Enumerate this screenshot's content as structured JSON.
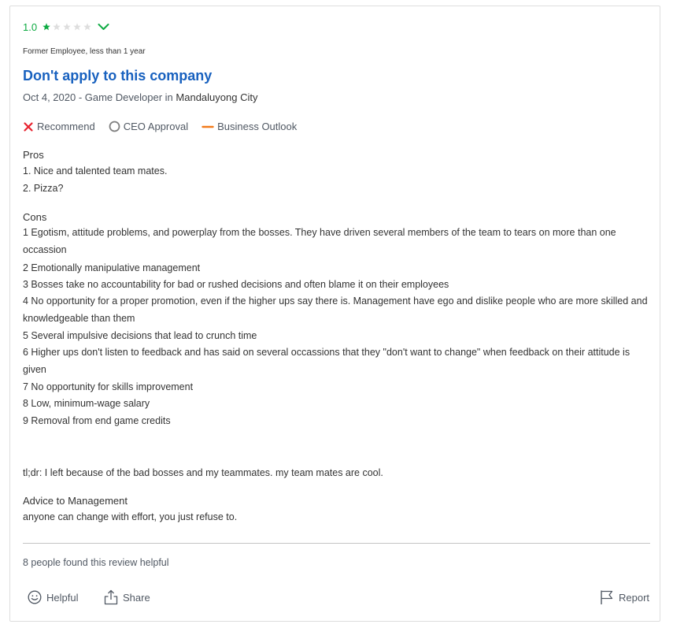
{
  "review": {
    "rating_value": "1.0",
    "rating_stars_filled": 1,
    "rating_stars_total": 5,
    "employee_status": "Former Employee, less than 1 year",
    "title": "Don't apply to this company",
    "date_role": "Oct 4, 2020 - Game Developer",
    "in_word": "in",
    "location": "Mandaluyong City",
    "indicators": {
      "recommend": "Recommend",
      "ceo_approval": "CEO Approval",
      "business_outlook": "Business Outlook"
    },
    "pros_heading": "Pros",
    "pros": [
      "1. Nice and talented team mates.",
      "2. Pizza?"
    ],
    "cons_heading": "Cons",
    "cons": [
      "1 Egotism, attitude problems, and powerplay from the bosses. They have driven several members of the team to tears on more than one occassion",
      "2 Emotionally manipulative management",
      "3 Bosses take no accountability for bad or rushed decisions and often blame it on their employees",
      "4 No opportunity for a proper promotion, even if the higher ups say there is. Management have ego and dislike people who are more skilled and knowledgeable than them",
      "5 Several impulsive decisions that lead to crunch time",
      "6 Higher ups don't listen to feedback and has said on several occassions that they \"don't want to change\" when feedback on their attitude is given",
      "7 No opportunity for skills improvement",
      "8 Low, minimum-wage salary",
      "9 Removal from end game credits"
    ],
    "tldr": "tl;dr: I left because of the bad bosses and my teammates. my team mates are cool.",
    "advice_heading": "Advice to Management",
    "advice": "anyone can change with effort, you just refuse to.",
    "helpful_count": "8 people found this review helpful",
    "actions": {
      "helpful": "Helpful",
      "share": "Share",
      "report": "Report"
    }
  },
  "colors": {
    "rating_green": "#0caa41",
    "title_blue": "#1861bf",
    "recommend_red": "#e8222e",
    "outlook_orange": "#f27b1b",
    "star_empty": "#dedede"
  }
}
